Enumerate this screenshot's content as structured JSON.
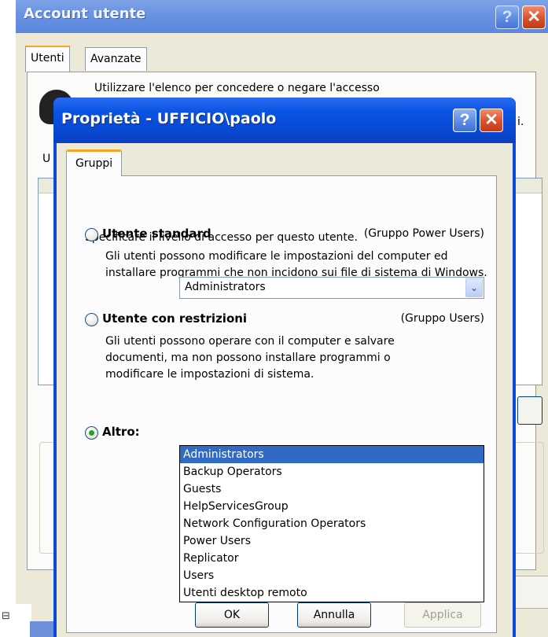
{
  "outer_window": {
    "title": "Account utente",
    "tabs": [
      "Utenti",
      "Avanzate"
    ],
    "selected_tab": "Utenti",
    "desc_fragment": "Utilizzare l'elenco per concedere o negare l'accesso",
    "desc_tail": "i.",
    "list_label_fragment": "U",
    "help_label": "?",
    "close_label": "✕"
  },
  "dialog": {
    "title": "Proprietà - UFFICIO\\paolo",
    "help_label": "?",
    "close_label": "✕",
    "tab": "Gruppi",
    "intro": "Specificare il livello di accesso  per questo utente.",
    "options": [
      {
        "title": "Utente standard",
        "group": "(Gruppo Power Users)",
        "description": "Gli utenti possono modificare le impostazioni del computer ed installare programmi che non incidono sui file di sistema di Windows.",
        "selected": false
      },
      {
        "title": "Utente con restrizioni",
        "group": "(Gruppo Users)",
        "description": "Gli utenti possono operare con il computer e salvare documenti, ma non possono installare programmi o modificare le impostazioni di sistema.",
        "selected": false
      },
      {
        "title": "Altro:",
        "selected": true
      }
    ],
    "combo": {
      "value": "Administrators",
      "arrow_icon": "chevron-down-icon",
      "options": [
        "Administrators",
        "Backup Operators",
        "Guests",
        "HelpServicesGroup",
        "Network Configuration Operators",
        "Power Users",
        "Replicator",
        "Users",
        "Utenti desktop remoto"
      ],
      "highlighted": "Administrators"
    },
    "buttons": {
      "ok": "OK",
      "cancel": "Annulla",
      "apply": "Applica"
    }
  },
  "colors": {
    "title_bar": "#0a54e3",
    "selection": "#316ac5",
    "tab_accent": "#f5a623",
    "dialog_bg": "#ece9d8"
  }
}
